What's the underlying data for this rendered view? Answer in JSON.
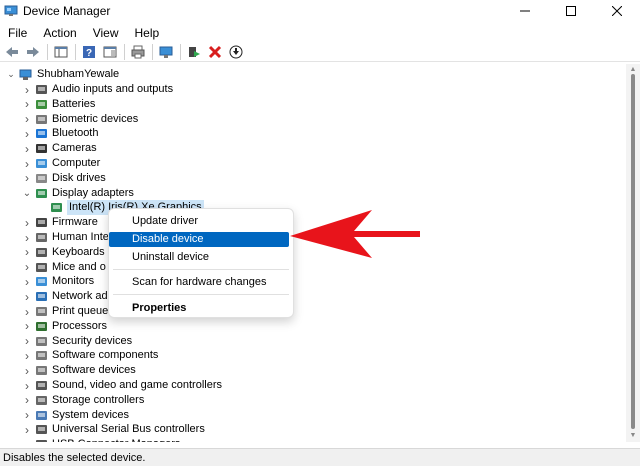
{
  "window": {
    "title": "Device Manager",
    "controls": [
      "minimize",
      "maximize",
      "close"
    ]
  },
  "menubar": {
    "items": [
      "File",
      "Action",
      "View",
      "Help"
    ]
  },
  "toolbar": {
    "buttons": [
      "back-icon",
      "forward-icon",
      "show-hide-tree-icon",
      "properties-icon",
      "help-icon",
      "action-pane-icon",
      "print-icon",
      "monitor-icon",
      "update-driver-icon",
      "uninstall-icon",
      "download-icon"
    ]
  },
  "tree": {
    "root": "ShubhamYewale",
    "items": [
      {
        "label": "Audio inputs and outputs",
        "icon": "speaker-icon"
      },
      {
        "label": "Batteries",
        "icon": "battery-icon"
      },
      {
        "label": "Biometric devices",
        "icon": "fingerprint-icon"
      },
      {
        "label": "Bluetooth",
        "icon": "bluetooth-icon"
      },
      {
        "label": "Cameras",
        "icon": "camera-icon"
      },
      {
        "label": "Computer",
        "icon": "computer-icon"
      },
      {
        "label": "Disk drives",
        "icon": "disk-icon"
      },
      {
        "label": "Display adapters",
        "icon": "display-adapter-icon"
      },
      {
        "label": "Intel(R) Iris(R) Xe Graphics",
        "icon": "display-adapter-icon"
      },
      {
        "label": "Firmware",
        "icon": "firmware-icon"
      },
      {
        "label": "Human Inte",
        "icon": "hid-icon"
      },
      {
        "label": "Keyboards",
        "icon": "keyboard-icon"
      },
      {
        "label": "Mice and o",
        "icon": "mouse-icon"
      },
      {
        "label": "Monitors",
        "icon": "monitor-icon"
      },
      {
        "label": "Network ad",
        "icon": "network-icon"
      },
      {
        "label": "Print queue",
        "icon": "printer-icon"
      },
      {
        "label": "Processors",
        "icon": "processor-icon"
      },
      {
        "label": "Security devices",
        "icon": "security-icon"
      },
      {
        "label": "Software components",
        "icon": "software-icon"
      },
      {
        "label": "Software devices",
        "icon": "software-icon"
      },
      {
        "label": "Sound, video and game controllers",
        "icon": "sound-icon"
      },
      {
        "label": "Storage controllers",
        "icon": "storage-icon"
      },
      {
        "label": "System devices",
        "icon": "system-icon"
      },
      {
        "label": "Universal Serial Bus controllers",
        "icon": "usb-icon"
      },
      {
        "label": "USB Connector Managers",
        "icon": "usb-icon"
      }
    ]
  },
  "context_menu": {
    "items": [
      "Update driver",
      "Disable device",
      "Uninstall device",
      "Scan for hardware changes",
      "Properties"
    ],
    "highlighted": "Disable device"
  },
  "status": {
    "text": "Disables the selected device."
  },
  "colors": {
    "highlight": "#0067c0",
    "selection": "#cce4f7",
    "annotation_arrow": "#e8141b"
  }
}
